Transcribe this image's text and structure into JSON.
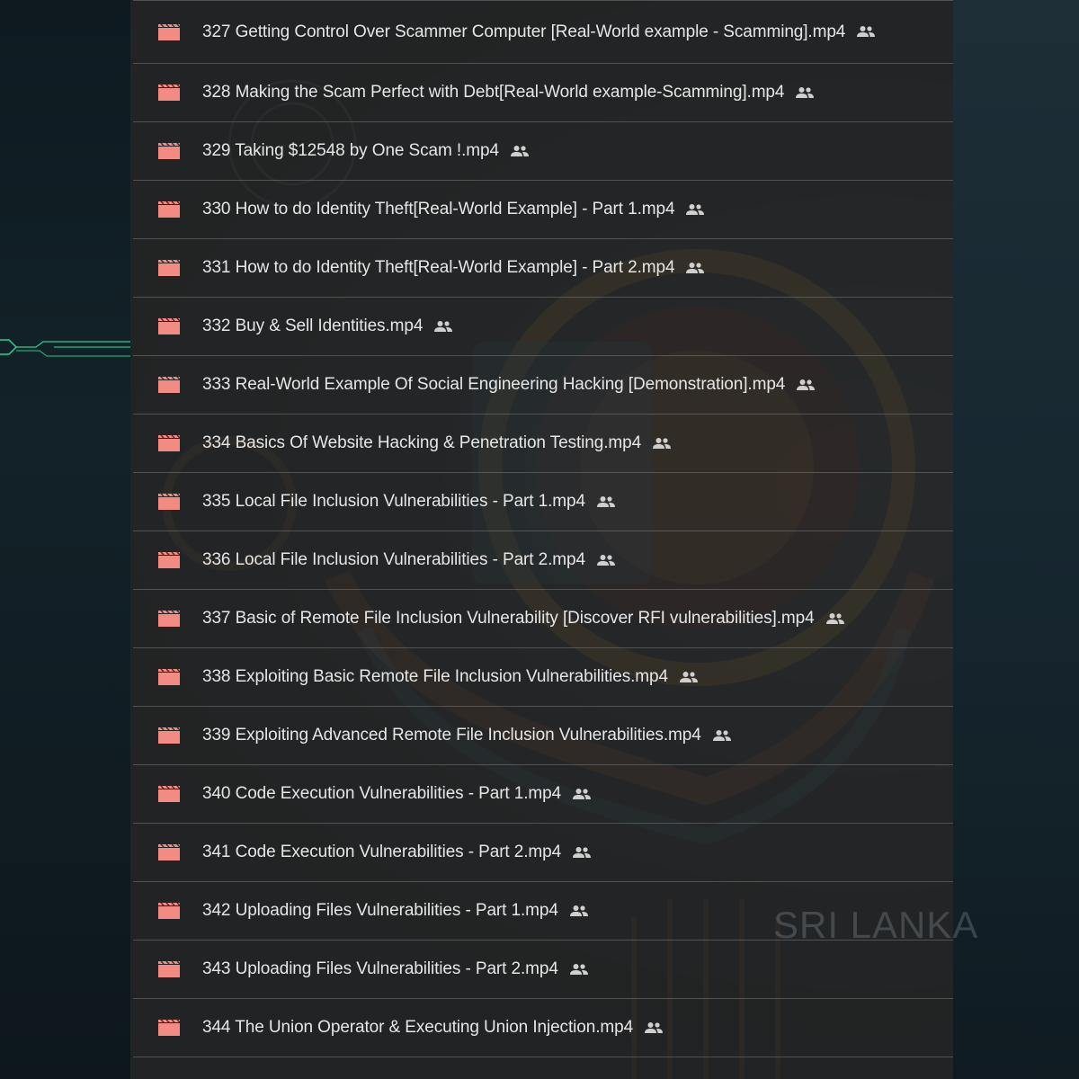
{
  "colors": {
    "video_icon": "#f28b82",
    "row_text": "#e6e6e6",
    "panel_bg": "#262626"
  },
  "watermark": "SRI LANKA",
  "files": [
    {
      "name": "327 Getting Control Over Scammer Computer [Real-World example - Scamming].mp4",
      "icon": "video-icon",
      "shared": true
    },
    {
      "name": "328 Making the Scam Perfect with Debt[Real-World example-Scamming].mp4",
      "icon": "video-icon",
      "shared": true
    },
    {
      "name": "329 Taking $12548 by One Scam !.mp4",
      "icon": "video-icon",
      "shared": true
    },
    {
      "name": "330 How to do Identity Theft[Real-World Example] - Part 1.mp4",
      "icon": "video-icon",
      "shared": true
    },
    {
      "name": "331 How to do Identity Theft[Real-World Example] - Part 2.mp4",
      "icon": "video-icon",
      "shared": true
    },
    {
      "name": "332 Buy & Sell Identities.mp4",
      "icon": "video-icon",
      "shared": true
    },
    {
      "name": "333 Real-World Example Of Social Engineering Hacking [Demonstration].mp4",
      "icon": "video-icon",
      "shared": true
    },
    {
      "name": "334 Basics Of Website Hacking & Penetration Testing.mp4",
      "icon": "video-icon",
      "shared": true
    },
    {
      "name": "335 Local File Inclusion Vulnerabilities - Part 1.mp4",
      "icon": "video-icon",
      "shared": true
    },
    {
      "name": "336 Local File Inclusion Vulnerabilities - Part 2.mp4",
      "icon": "video-icon",
      "shared": true
    },
    {
      "name": "337 Basic of Remote File Inclusion Vulnerability [Discover RFI vulnerabilities].mp4",
      "icon": "video-icon",
      "shared": true
    },
    {
      "name": "338 Exploiting Basic Remote File Inclusion Vulnerabilities.mp4",
      "icon": "video-icon",
      "shared": true
    },
    {
      "name": "339 Exploiting Advanced Remote File Inclusion Vulnerabilities.mp4",
      "icon": "video-icon",
      "shared": true
    },
    {
      "name": "340 Code Execution Vulnerabilities - Part 1.mp4",
      "icon": "video-icon",
      "shared": true
    },
    {
      "name": "341 Code Execution Vulnerabilities - Part 2.mp4",
      "icon": "video-icon",
      "shared": true
    },
    {
      "name": "342 Uploading Files Vulnerabilities - Part 1.mp4",
      "icon": "video-icon",
      "shared": true
    },
    {
      "name": "343 Uploading Files Vulnerabilities - Part 2.mp4",
      "icon": "video-icon",
      "shared": true
    },
    {
      "name": "344 The Union Operator & Executing Union Injection.mp4",
      "icon": "video-icon",
      "shared": true
    }
  ]
}
